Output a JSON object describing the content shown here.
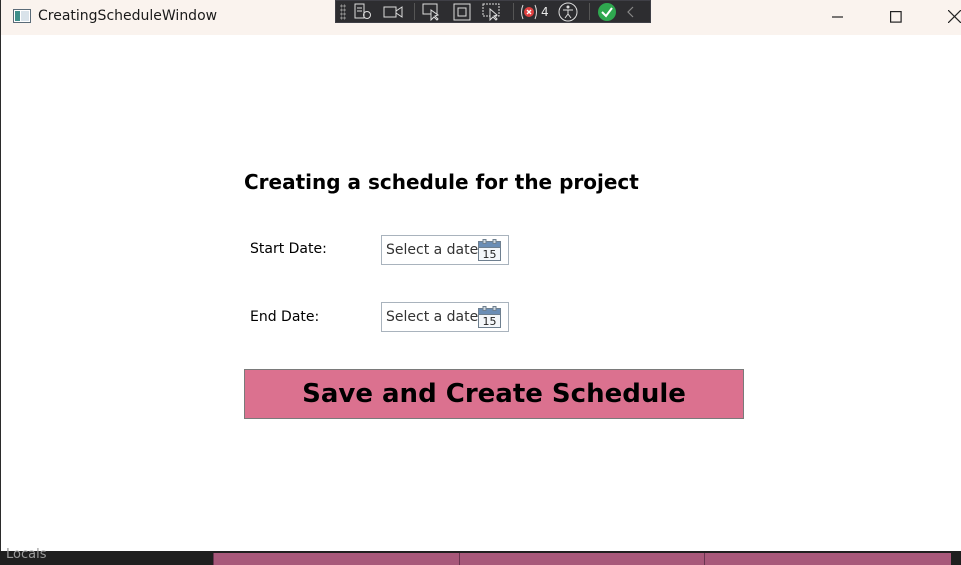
{
  "window": {
    "title": "CreatingScheduleWindow"
  },
  "debug_toolbar": {
    "error_count": "4",
    "buttons": [
      "live-visual-tree-icon",
      "record-icon",
      "select-element-icon",
      "display-layout-adorners-icon",
      "track-focused-element-icon",
      "binding-failures-icon",
      "accessibility-checker-icon",
      "status-ok-icon",
      "collapse-icon"
    ]
  },
  "form": {
    "heading": "Creating a schedule for the project",
    "start_date": {
      "label": "Start Date:",
      "placeholder": "Select a date",
      "calendar_day": "15"
    },
    "end_date": {
      "label": "End Date:",
      "placeholder": "Select a date",
      "calendar_day": "15"
    },
    "save_button": "Save and Create Schedule"
  },
  "bottom_panel": {
    "label": "Locals"
  },
  "colors": {
    "save_button_bg": "#db718f",
    "titlebar_bg": "#faf3ee",
    "accent_tab": "#a8587a"
  }
}
